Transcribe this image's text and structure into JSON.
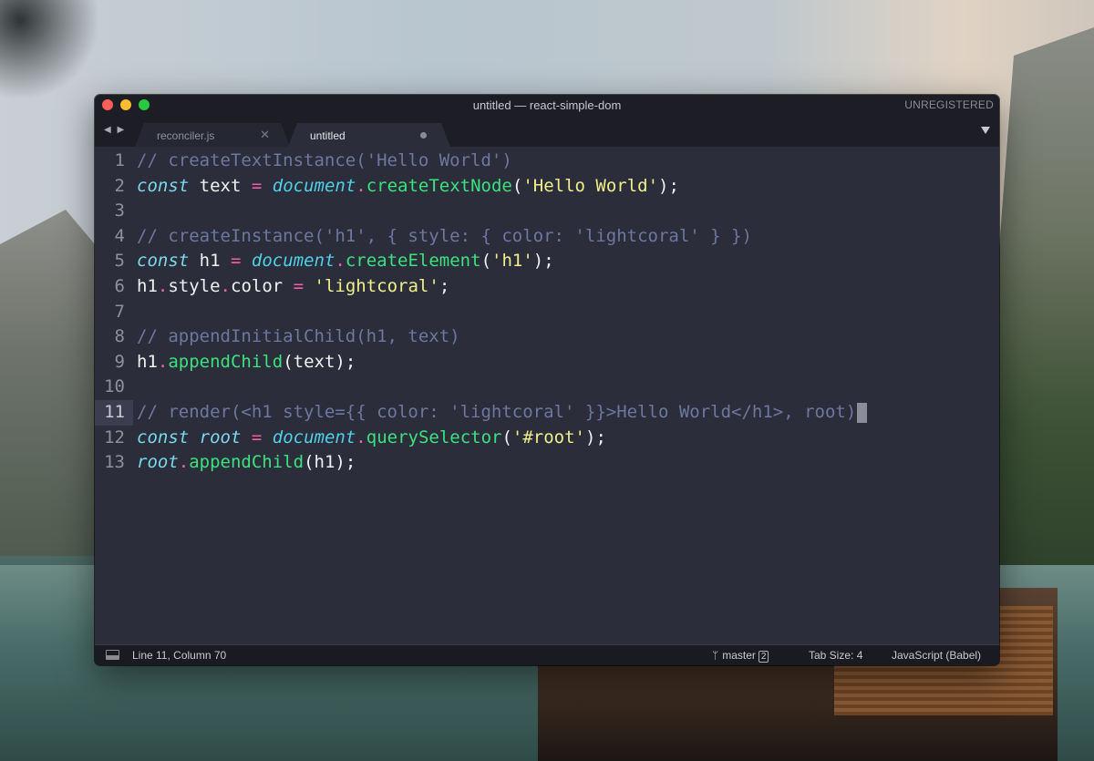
{
  "window": {
    "title": "untitled — react-simple-dom",
    "registration": "UNREGISTERED",
    "nav_arrows": "◀ ▶",
    "tab_menu_icon": "triangle-down"
  },
  "tabs": [
    {
      "label": "reconciler.js",
      "active": false,
      "close_glyph": "✕"
    },
    {
      "label": "untitled",
      "active": true,
      "dirty": true
    }
  ],
  "editor": {
    "current_line": 11,
    "lines": [
      {
        "n": "1",
        "tokens": [
          {
            "t": "// createTextInstance('Hello World')",
            "c": "comment"
          }
        ]
      },
      {
        "n": "2",
        "tokens": [
          {
            "t": "const",
            "c": "kw"
          },
          {
            "t": " text ",
            "c": "plain"
          },
          {
            "t": "=",
            "c": "op"
          },
          {
            "t": " ",
            "c": "plain"
          },
          {
            "t": "document",
            "c": "doc"
          },
          {
            "t": ".",
            "c": "op"
          },
          {
            "t": "createTextNode",
            "c": "fn"
          },
          {
            "t": "(",
            "c": "plain"
          },
          {
            "t": "'Hello World'",
            "c": "str"
          },
          {
            "t": ");",
            "c": "plain"
          }
        ]
      },
      {
        "n": "3",
        "tokens": []
      },
      {
        "n": "4",
        "tokens": [
          {
            "t": "// createInstance('h1', { style: { color: 'lightcoral' } })",
            "c": "comment"
          }
        ]
      },
      {
        "n": "5",
        "tokens": [
          {
            "t": "const",
            "c": "kw"
          },
          {
            "t": " h1 ",
            "c": "plain"
          },
          {
            "t": "=",
            "c": "op"
          },
          {
            "t": " ",
            "c": "plain"
          },
          {
            "t": "document",
            "c": "doc"
          },
          {
            "t": ".",
            "c": "op"
          },
          {
            "t": "createElement",
            "c": "fn"
          },
          {
            "t": "(",
            "c": "plain"
          },
          {
            "t": "'h1'",
            "c": "str"
          },
          {
            "t": ");",
            "c": "plain"
          }
        ]
      },
      {
        "n": "6",
        "tokens": [
          {
            "t": "h1",
            "c": "plain"
          },
          {
            "t": ".",
            "c": "op"
          },
          {
            "t": "style",
            "c": "plain"
          },
          {
            "t": ".",
            "c": "op"
          },
          {
            "t": "color ",
            "c": "plain"
          },
          {
            "t": "=",
            "c": "op"
          },
          {
            "t": " ",
            "c": "plain"
          },
          {
            "t": "'lightcoral'",
            "c": "str"
          },
          {
            "t": ";",
            "c": "plain"
          }
        ]
      },
      {
        "n": "7",
        "tokens": []
      },
      {
        "n": "8",
        "tokens": [
          {
            "t": "// appendInitialChild(h1, text)",
            "c": "comment"
          }
        ]
      },
      {
        "n": "9",
        "tokens": [
          {
            "t": "h1",
            "c": "plain"
          },
          {
            "t": ".",
            "c": "op"
          },
          {
            "t": "appendChild",
            "c": "fn"
          },
          {
            "t": "(text);",
            "c": "plain"
          }
        ]
      },
      {
        "n": "10",
        "tokens": []
      },
      {
        "n": "11",
        "tokens": [
          {
            "t": "// render(<h1 style={{ color: 'lightcoral' }}>Hello World</h1>, root)",
            "c": "comment"
          }
        ],
        "cursor": true
      },
      {
        "n": "12",
        "tokens": [
          {
            "t": "const",
            "c": "kw"
          },
          {
            "t": " ",
            "c": "plain"
          },
          {
            "t": "root",
            "c": "kw"
          },
          {
            "t": " ",
            "c": "plain"
          },
          {
            "t": "=",
            "c": "op"
          },
          {
            "t": " ",
            "c": "plain"
          },
          {
            "t": "document",
            "c": "doc"
          },
          {
            "t": ".",
            "c": "op"
          },
          {
            "t": "querySelector",
            "c": "fn"
          },
          {
            "t": "(",
            "c": "plain"
          },
          {
            "t": "'#root'",
            "c": "str"
          },
          {
            "t": ");",
            "c": "plain"
          }
        ]
      },
      {
        "n": "13",
        "tokens": [
          {
            "t": "root",
            "c": "kw"
          },
          {
            "t": ".",
            "c": "op"
          },
          {
            "t": "appendChild",
            "c": "fn"
          },
          {
            "t": "(h1);",
            "c": "plain"
          }
        ]
      }
    ]
  },
  "statusbar": {
    "position": "Line 11, Column 70",
    "branch": "master",
    "branch_icon": "git-branch",
    "changes": "2",
    "tab_size": "Tab Size: 4",
    "syntax": "JavaScript (Babel)"
  },
  "colors": {
    "editor_bg": "#2b2d3a",
    "chrome_bg": "#1c1d25",
    "comment": "#6d77a0",
    "keyword": "#7ad9ec",
    "function": "#3be27d",
    "string": "#f1ef8a",
    "operator": "#f35ea8"
  }
}
